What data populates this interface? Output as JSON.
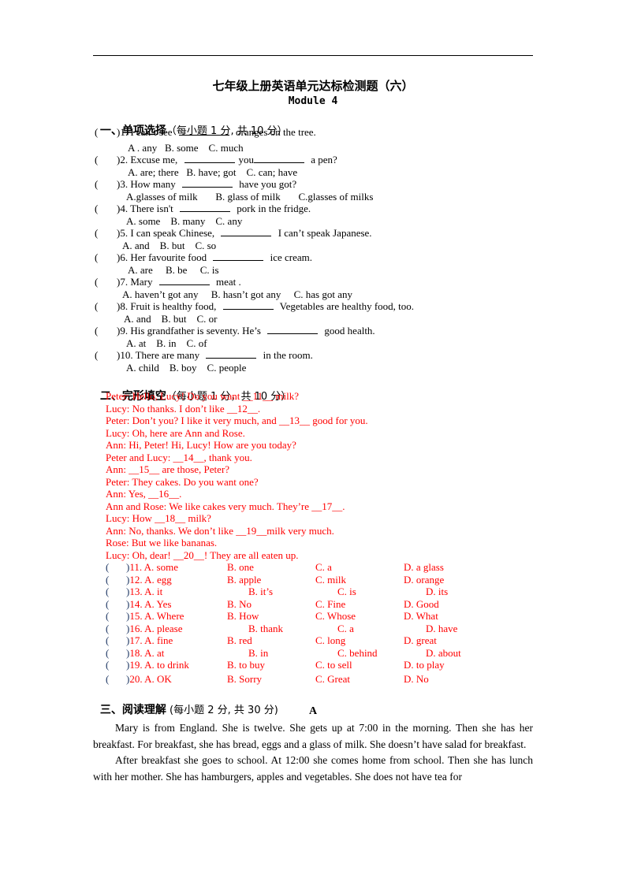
{
  "title": "七年级上册英语单元达标检测题（六）",
  "module": "Module 4",
  "sections": {
    "one": {
      "label": "一、单项选择",
      "note": "（每小题 1 分, 共 10 分）"
    },
    "two": {
      "label": "二、完形填空",
      "note": "（每小题 1 分，共 10 分）"
    },
    "three": {
      "label": "三、阅读理解",
      "note": " (每小题 2 分, 共 30 分)"
    }
  },
  "mc_questions": [
    {
      "paren": "(      )",
      "pre": "1. I can’t see ",
      "blanks": 1,
      "post": " oranges on the tree.",
      "options": "A . any   B. some    C. much"
    },
    {
      "paren": "(      )",
      "pre": "2. Excuse me, ",
      "mid": " you",
      "post": " a pen?",
      "options": "A. are; there   B. have; got    C. can; have"
    },
    {
      "paren": "(      )",
      "pre": "3. How many ",
      "post": " have you got?",
      "options": "A.glasses of milk       B. glass of milk       C.glasses of milks"
    },
    {
      "paren": "(      )",
      "pre": "4. There isn't ",
      "post": " pork in the fridge.",
      "options": "A. some    B. many    C. any"
    },
    {
      "paren": "(      )",
      "pre": "5. I can speak Chinese, ",
      "post": " I can’t speak Japanese.",
      "options": "A. and    B. but    C. so"
    },
    {
      "paren": "(      )",
      "pre": "6. Her favourite food ",
      "post": " ice cream.",
      "options": "A. are     B. be     C. is"
    },
    {
      "paren": "(      )",
      "pre": "7. Mary ",
      "post": " meat .",
      "options": "A. haven’t got any     B. hasn’t got any     C. has got any"
    },
    {
      "paren": "(      )",
      "pre": "8. Fruit is healthy food, ",
      "post": " Vegetables are healthy food, too.",
      "options": "A. and    B. but    C. or"
    },
    {
      "paren": "(      )",
      "pre": "9. His grandfather is seventy. He’s ",
      "post": " good health.",
      "options": "A. at    B. in    C. of"
    },
    {
      "paren": "(      )",
      "pre": "10. There are many ",
      "post": " in the room.",
      "options": "A. child    B. boy    C. people"
    }
  ],
  "cloze_dialogue": [
    "Peter: Hello, Lucy! Do you want __11__ milk?",
    "Lucy: No thanks. I don’t like __12__.",
    "Peter: Don’t you? I like it very much, and __13__ good for you.",
    "Lucy: Oh, here are Ann and Rose.",
    "Ann: Hi, Peter! Hi, Lucy! How are you today?",
    "Peter and Lucy: __14__, thank you.",
    "Ann: __15__ are those, Peter?",
    "Peter: They cakes. Do you want one?",
    "Ann: Yes, __16__.",
    "Ann and Rose: We like cakes very much. They’re __17__.",
    "Lucy: How __18__ milk?",
    "Ann: No, thanks. We don’t like __19__milk very much.",
    "Rose: But we like bananas.",
    "Lucy: Oh, dear! __20__! They are all eaten up."
  ],
  "cloze_options": [
    {
      "num": ")11. A. some",
      "b": "B. one",
      "c": "C. a",
      "d": "D. a glass",
      "shift": false
    },
    {
      "num": ")12. A. egg",
      "b": "B. apple",
      "c": "C. milk",
      "d": "D. orange",
      "shift": false
    },
    {
      "num": ")13. A. it",
      "b": "B. it’s",
      "c": "C. is",
      "d": "D. its",
      "shift": true
    },
    {
      "num": ")14. A. Yes",
      "b": "B. No",
      "c": "C. Fine",
      "d": "D. Good",
      "shift": false
    },
    {
      "num": ")15. A. Where",
      "b": "B. How",
      "c": "C. Whose",
      "d": "D. What",
      "shift": false
    },
    {
      "num": ")16. A. please",
      "b": "B. thank",
      "c": "C. a",
      "d": "D. have",
      "shift": true
    },
    {
      "num": ")17. A. fine",
      "b": "B. red",
      "c": "C. long",
      "d": "D. great",
      "shift": false
    },
    {
      "num": ")18. A. at",
      "b": "B. in",
      "c": "C. behind",
      "d": "D. about",
      "shift": true
    },
    {
      "num": ")19. A. to drink",
      "b": "B. to buy",
      "c": "C. to sell",
      "d": "D. to play",
      "shift": false
    },
    {
      "num": ")20. A. OK",
      "b": "B. Sorry",
      "c": "C. Great",
      "d": "D. No",
      "shift": false
    }
  ],
  "reading": {
    "heading": "A",
    "paragraphs": [
      "Mary is from England. She is twelve. She gets up at 7:00 in the morning. Then she has her breakfast. For breakfast, she has bread, eggs and a glass of milk. She doesn’t have salad for breakfast.",
      "After breakfast she goes to school. At 12:00 she comes home from school. Then she has lunch with her mother. She has hamburgers, apples and vegetables. She does not have tea for"
    ]
  },
  "colors": {
    "cloze_text": "#ff0000",
    "paren": "#1f3864",
    "text": "#000000"
  }
}
